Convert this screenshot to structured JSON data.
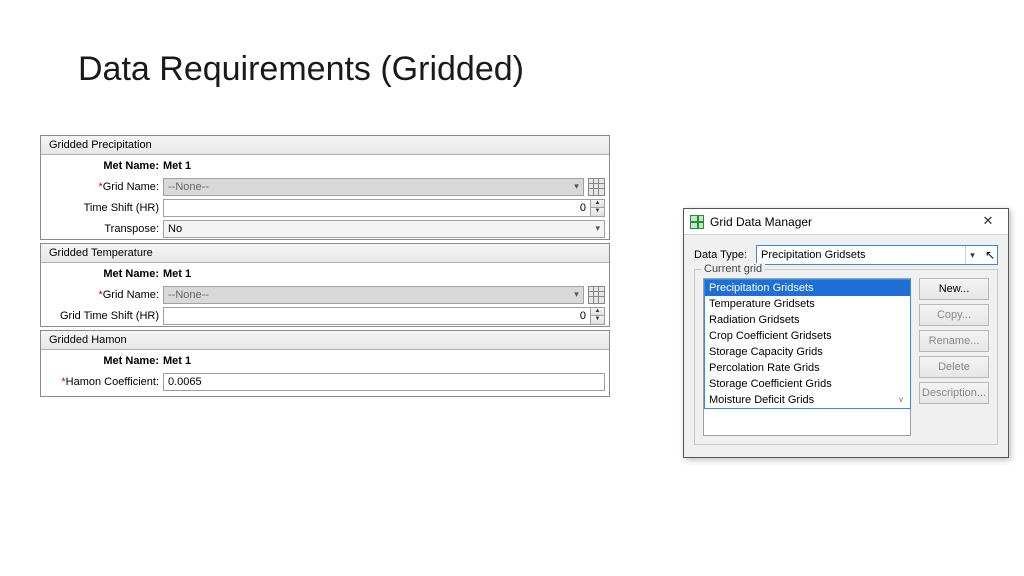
{
  "title": "Data Requirements (Gridded)",
  "panels": {
    "precip": {
      "tab": "Gridded Precipitation",
      "met_label": "Met Name:",
      "met_value": "Met 1",
      "grid_label": "Grid Name:",
      "grid_value": "--None--",
      "shift_label": "Time Shift (HR)",
      "shift_value": "0",
      "transpose_label": "Transpose:",
      "transpose_value": "No"
    },
    "temp": {
      "tab": "Gridded Temperature",
      "met_label": "Met Name:",
      "met_value": "Met 1",
      "grid_label": "Grid Name:",
      "grid_value": "--None--",
      "shift_label": "Grid Time Shift (HR)",
      "shift_value": "0"
    },
    "hamon": {
      "tab": "Gridded Hamon",
      "met_label": "Met Name:",
      "met_value": "Met 1",
      "coef_label": "Hamon Coefficient:",
      "coef_value": "0.0065"
    }
  },
  "dialog": {
    "title": "Grid Data Manager",
    "datatype_label": "Data Type:",
    "datatype_value": "Precipitation Gridsets",
    "fieldset_label": "Current grid",
    "options": [
      "Precipitation Gridsets",
      "Temperature Gridsets",
      "Radiation Gridsets",
      "Crop Coefficient Gridsets",
      "Storage Capacity Grids",
      "Percolation Rate Grids",
      "Storage Coefficient Grids",
      "Moisture Deficit Grids"
    ],
    "buttons": {
      "new": "New...",
      "copy": "Copy...",
      "rename": "Rename...",
      "delete": "Delete",
      "desc": "Description..."
    }
  }
}
